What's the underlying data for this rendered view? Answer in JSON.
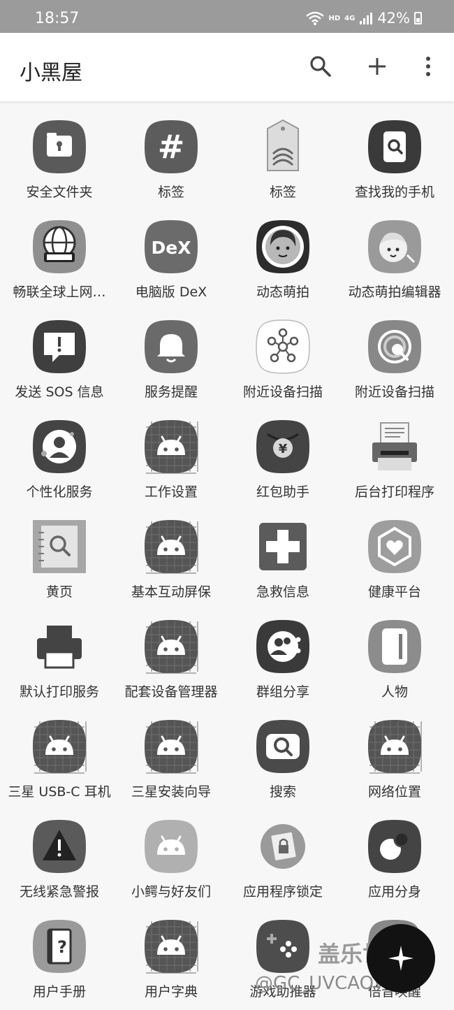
{
  "status_bar": {
    "time": "18:57",
    "network": "HD",
    "signal": "4G",
    "battery": "42%"
  },
  "app_bar": {
    "title": "小黑屋",
    "actions": [
      "search-icon",
      "add-icon",
      "more-vert-icon"
    ]
  },
  "apps": [
    {
      "label": "安全文件夹",
      "icon": "secure-folder-icon"
    },
    {
      "label": "标签",
      "icon": "hashtag-icon"
    },
    {
      "label": "标签",
      "icon": "nfc-tag-icon"
    },
    {
      "label": "查找我的手机",
      "icon": "find-my-mobile-icon"
    },
    {
      "label": "畅联全球上网…",
      "icon": "global-roaming-icon"
    },
    {
      "label": "电脑版 DeX",
      "icon": "dex-icon"
    },
    {
      "label": "动态萌拍",
      "icon": "ar-emoji-icon"
    },
    {
      "label": "动态萌拍编辑器",
      "icon": "ar-emoji-editor-icon"
    },
    {
      "label": "发送 SOS 信息",
      "icon": "sos-message-icon"
    },
    {
      "label": "服务提醒",
      "icon": "bell-icon"
    },
    {
      "label": "附近设备扫描",
      "icon": "nearby-device-scan-icon"
    },
    {
      "label": "附近设备扫描",
      "icon": "nearby-scan-radar-icon"
    },
    {
      "label": "个性化服务",
      "icon": "personalization-icon"
    },
    {
      "label": "工作设置",
      "icon": "android-icon"
    },
    {
      "label": "红包助手",
      "icon": "red-envelope-icon"
    },
    {
      "label": "后台打印程序",
      "icon": "print-spooler-icon"
    },
    {
      "label": "黄页",
      "icon": "yellow-pages-icon"
    },
    {
      "label": "基本互动屏保",
      "icon": "android-icon"
    },
    {
      "label": "急救信息",
      "icon": "first-aid-icon"
    },
    {
      "label": "健康平台",
      "icon": "health-platform-icon"
    },
    {
      "label": "默认打印服务",
      "icon": "printer-icon"
    },
    {
      "label": "配套设备管理器",
      "icon": "android-icon"
    },
    {
      "label": "群组分享",
      "icon": "group-share-icon"
    },
    {
      "label": "人物",
      "icon": "people-icon"
    },
    {
      "label": "三星 USB-C 耳机",
      "icon": "android-icon"
    },
    {
      "label": "三星安装向导",
      "icon": "android-icon"
    },
    {
      "label": "搜索",
      "icon": "search-app-icon"
    },
    {
      "label": "网络位置",
      "icon": "android-icon"
    },
    {
      "label": "无线紧急警报",
      "icon": "warning-icon"
    },
    {
      "label": "小鳄与好友们",
      "icon": "android-plain-icon"
    },
    {
      "label": "应用程序锁定",
      "icon": "app-lock-icon"
    },
    {
      "label": "应用分身",
      "icon": "dual-messenger-icon"
    },
    {
      "label": "用户手册",
      "icon": "user-manual-icon"
    },
    {
      "label": "用户字典",
      "icon": "android-icon"
    },
    {
      "label": "游戏助推器",
      "icon": "game-booster-icon"
    },
    {
      "label": "倍音唤醒",
      "icon": "voice-wakeup-icon"
    }
  ],
  "watermark": {
    "line1": "盖乐世社区",
    "line2": "@GC_UVCAOW1B"
  }
}
